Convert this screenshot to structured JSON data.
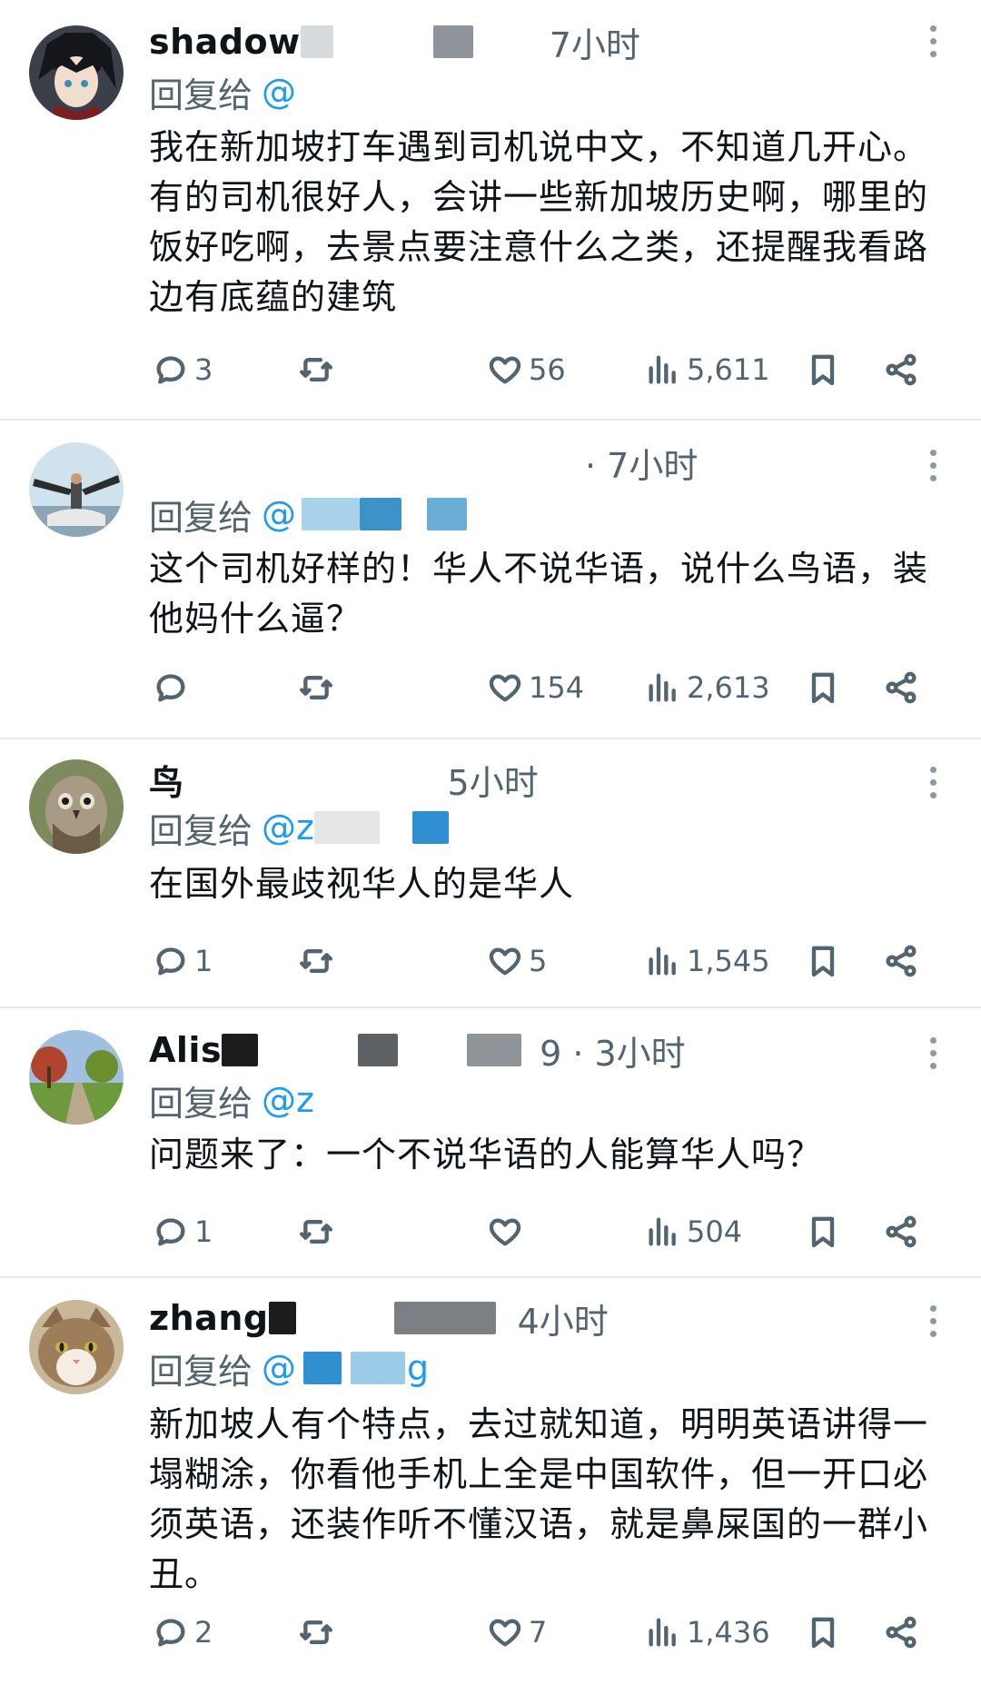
{
  "tweets": [
    {
      "name": "shadow",
      "time": "7小时",
      "reply_prefix": "回复给",
      "reply_handle": "@",
      "text": "我在新加坡打车遇到司机说中文，不知道几开心。有的司机很好人，会讲一些新加坡历史啊，哪里的饭好吃啊，去景点要注意什么之类，还提醒我看路边有底蕴的建筑",
      "replies": "3",
      "retweets": "",
      "likes": "56",
      "views": "5,611"
    },
    {
      "name": "",
      "time": "· 7小时",
      "reply_prefix": "回复给",
      "reply_handle": "@",
      "text": "这个司机好样的！华人不说华语，说什么鸟语，装他妈什么逼？",
      "replies": "",
      "retweets": "",
      "likes": "154",
      "views": "2,613"
    },
    {
      "name": "鸟",
      "time": "5小时",
      "reply_prefix": "回复给",
      "reply_handle": "@z",
      "text": "在国外最歧视华人的是华人",
      "replies": "1",
      "retweets": "",
      "likes": "5",
      "views": "1,545"
    },
    {
      "name": "Alis",
      "time": "9 · 3小时",
      "reply_prefix": "回复给",
      "reply_handle": "@z",
      "text": "问题来了：一个不说华语的人能算华人吗？",
      "replies": "1",
      "retweets": "",
      "likes": "",
      "views": "504"
    },
    {
      "name": "zhang",
      "time": "4小时",
      "reply_prefix": "回复给",
      "reply_handle": "@",
      "reply_handle_tail": "g",
      "text": "新加坡人有个特点，去过就知道，明明英语讲得一塌糊涂，你看他手机上全是中国软件，但一开口必须英语，还装作听不懂汉语，就是鼻屎国的一群小丑。",
      "replies": "2",
      "retweets": "",
      "likes": "7",
      "views": "1,436"
    }
  ],
  "icons": {
    "reply": "reply-icon",
    "retweet": "retweet-icon",
    "like": "heart-icon",
    "views": "views-icon",
    "bookmark": "bookmark-icon",
    "share": "share-icon",
    "more": "more-icon"
  },
  "colors": {
    "handle": "#1d9bf0",
    "muted": "#536471",
    "text": "#0f1419",
    "divider": "#e6e9ec"
  }
}
